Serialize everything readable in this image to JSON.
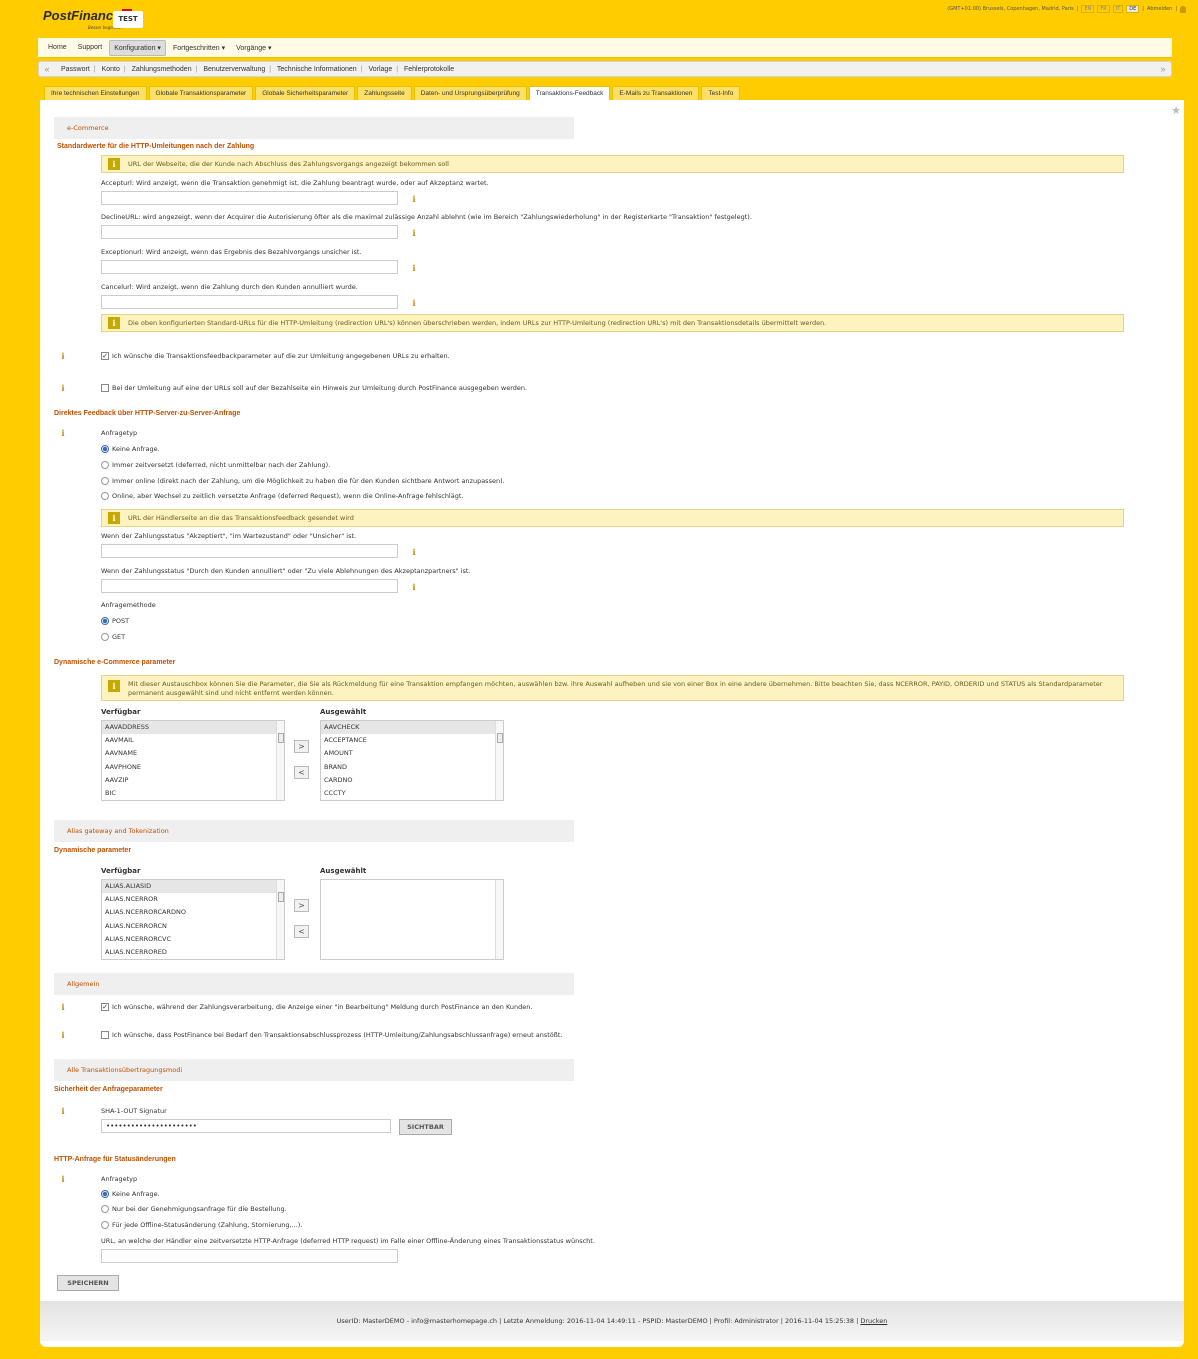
{
  "header": {
    "logo": "PostFinance",
    "tagline": "Besser begleitet.",
    "env_badge": "TEST",
    "timezone": "(GMT+01:00) Brussels, Copenhagen, Madrid, Paris",
    "languages": [
      "EN",
      "FR",
      "IT",
      "DE"
    ],
    "active_language": "DE",
    "logout": "Abmelden"
  },
  "mainmenu": [
    {
      "label": "Home"
    },
    {
      "label": "Support"
    },
    {
      "label": "Konfiguration ▾",
      "active": true
    },
    {
      "label": "Fortgeschritten ▾"
    },
    {
      "label": "Vorgänge ▾"
    }
  ],
  "submenu": [
    "Passwort",
    "Konto",
    "Zahlungsmethoden",
    "Benutzerverwaltung",
    "Technische Informationen",
    "Vorlage",
    "Fehlerprotokolle"
  ],
  "tabs": [
    {
      "label": "Ihre technischen Einstellungen"
    },
    {
      "label": "Globale Transaktionsparameter"
    },
    {
      "label": "Globale Sicherheitsparameter"
    },
    {
      "label": "Zahlungsseite"
    },
    {
      "label": "Daten- und Ursprungsüberprüfung"
    },
    {
      "label": "Transaktions-Feedback",
      "active": true
    },
    {
      "label": "E-Mails zu Transaktionen"
    },
    {
      "label": "Test-Info"
    }
  ],
  "ecommerce": {
    "section": "e-Commerce",
    "heading": "Standardwerte für die HTTP-Umleitungen nach der Zahlung",
    "note1": "URL der Webseite, die der Kunde nach Abschluss des Zahlungsvorgangs angezeigt bekommen soll",
    "accept_label": "Accepturl: Wird anzeigt, wenn die Transaktion genehmigt ist, die Zahlung beantragt wurde, oder auf Akzeptanz wartet.",
    "decline_label": "DeclineURL: wird angezeigt, wenn der Acquirer die Autorisierung öfter als die maximal zulässige Anzahl ablehnt (wie im Bereich \"Zahlungswiederholung\" in der Registerkarte \"Transaktion\" festgelegt).",
    "exception_label": "Exceptionurl: Wird anzeigt, wenn das Ergebnis des Bezahlvorgangs unsicher ist.",
    "cancel_label": "Cancelurl: Wird anzeigt, wenn die Zahlung durch den Kunden annulliert wurde.",
    "note2": "Die oben konfigurierten Standard-URLs für die HTTP-Umleitung (redirection URL's) können überschrieben werden, indem URLs zur HTTP-Umleitung (redirection URL's) mit den Transaktionsdetails übermittelt werden.",
    "check1": "Ich wünsche die Transaktionsfeedbackparameter auf die zur Umleitung angegebenen URLs zu erhalten.",
    "check1_checked": true,
    "check2": "Bei der Umleitung auf eine der URLs soll auf der Bezahlseite ein Hinweis zur Umleitung durch PostFinance ausgegeben werden.",
    "check2_checked": false
  },
  "direct": {
    "heading": "Direktes Feedback über HTTP-Server-zu-Server-Anfrage",
    "type_label": "Anfragetyp",
    "options": [
      "Keine Anfrage.",
      "Immer zeitversetzt (deferred, nicht unmittelbar nach der Zahlung).",
      "Immer online (direkt nach der Zahlung, um die Möglichkeit zu haben die für den Kunden sichtbare Antwort anzupassen).",
      "Online, aber Wechsel zu zeitlich versetzte Anfrage (deferred Request), wenn die Online-Anfrage fehlschlägt."
    ],
    "selected": 0,
    "note": "URL der Händlerseite an die das Transaktionsfeedback gesendet wird",
    "url1_label": "Wenn der Zahlungsstatus \"Akzeptiert\", \"im Wartezustand\" oder \"Unsicher\" ist.",
    "url2_label": "Wenn der Zahlungsstatus \"Durch den Kunden annulliert\" oder \"Zu viele Ablehnungen des Akzeptanzpartners\" ist.",
    "method_label": "Anfragemethode",
    "methods": [
      "POST",
      "GET"
    ],
    "method_selected": 0
  },
  "dynamic": {
    "heading": "Dynamische e-Commerce parameter",
    "note": "Mit dieser Austauschbox können Sie die Parameter, die Sie als Rückmeldung für eine Transaktion empfangen möchten, auswählen bzw. ihre Auswahl aufheben und sie von einer Box in eine andere übernehmen. Bitte beachten Sie, dass NCERROR, PAYID, ORDERID und STATUS als Standardparameter permanent ausgewählt sind und nicht entfernt werden können.",
    "available_label": "Verfügbar",
    "selected_label": "Ausgewählt",
    "available": [
      "AAVADDRESS",
      "AAVMAIL",
      "AAVNAME",
      "AAVPHONE",
      "AAVZIP",
      "BIC"
    ],
    "selected": [
      "AAVCHECK",
      "ACCEPTANCE",
      "AMOUNT",
      "BRAND",
      "CARDNO",
      "CCCTY"
    ]
  },
  "alias": {
    "section": "Alias gateway and Tokenization",
    "heading": "Dynamische parameter",
    "available_label": "Verfügbar",
    "selected_label": "Ausgewählt",
    "available": [
      "ALIAS.ALIASID",
      "ALIAS.NCERROR",
      "ALIAS.NCERRORCARDNO",
      "ALIAS.NCERRORCN",
      "ALIAS.NCERRORCVC",
      "ALIAS.NCERRORED"
    ],
    "selected": []
  },
  "general": {
    "section": "Allgemein",
    "check1": "Ich wünsche, während der Zahlungsverarbeitung, die Anzeige einer \"in Bearbeitung\" Meldung durch PostFinance an den Kunden.",
    "check1_checked": true,
    "check2": "Ich wünsche, dass PostFinance bei Bedarf den Transaktionsabschlussprozess (HTTP-Umleitung/Zahlungsabschlussanfrage) erneut anstößt.",
    "check2_checked": false
  },
  "allmodes": {
    "section": "Alle Transaktionsübertragungsmodi",
    "heading": "Sicherheit der Anfrageparameter",
    "sha_label": "SHA-1-OUT Signatur",
    "sha_value": "••••••••••••••••••••••",
    "show_button": "SICHTBAR"
  },
  "status": {
    "heading": "HTTP-Anfrage für Statusänderungen",
    "type_label": "Anfragetyp",
    "options": [
      "Keine Anfrage.",
      "Nur bei der Genehmigungsanfrage für die Bestellung.",
      "Für jede Offline-Statusänderung (Zahlung, Stornierung,...)."
    ],
    "selected": 0,
    "url_label": "URL, an welche der Händler eine zeitversetzte HTTP-Anfrage (deferred HTTP request) im Falle einer Offline-Änderung eines Transaktionsstatus wünscht."
  },
  "save_button": "SPEICHERN",
  "footer": {
    "text": "UserID: MasterDEMO - info@masterhomepage.ch | Letzte Anmeldung: 2016-11-04 14:49:11 - PSPID: MasterDEMO | Profil: Administrator | 2016-11-04 15:25:38 |",
    "print": "Drucken"
  }
}
